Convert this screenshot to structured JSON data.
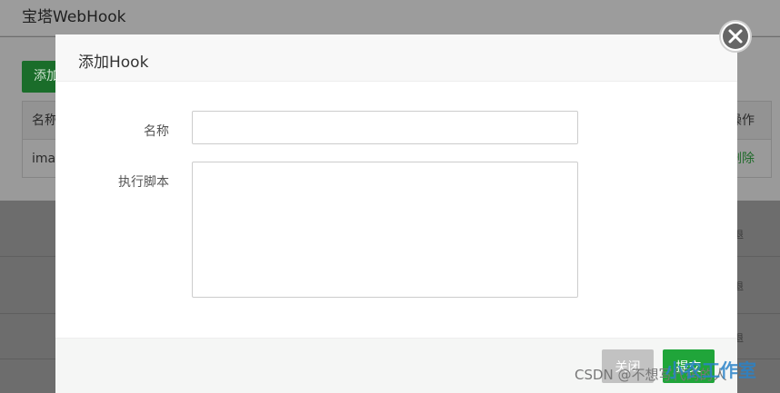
{
  "background": {
    "app_title": "宝塔WebHook",
    "add_button_label": "添加",
    "table": {
      "headers": {
        "name": "名称",
        "action": "操作"
      },
      "rows": [
        {
          "name": "ima",
          "action": "删除"
        }
      ]
    },
    "side_labels": [
      "退",
      "退",
      "退",
      "退"
    ]
  },
  "modal": {
    "title": "添加Hook",
    "fields": {
      "name": {
        "label": "名称",
        "value": "",
        "placeholder": ""
      },
      "script": {
        "label": "执行脚本",
        "value": "",
        "placeholder": ""
      }
    },
    "buttons": {
      "close": "关闭",
      "submit": "提交"
    }
  },
  "watermark": {
    "text": "CSDN @不想写代码的人",
    "logo_text": "小农工作室"
  },
  "colors": {
    "primary": "#20a53a",
    "close_button": "#c2c2c2",
    "overlay": "#6e6e6e"
  },
  "icons": {
    "close": "close-x-icon"
  }
}
